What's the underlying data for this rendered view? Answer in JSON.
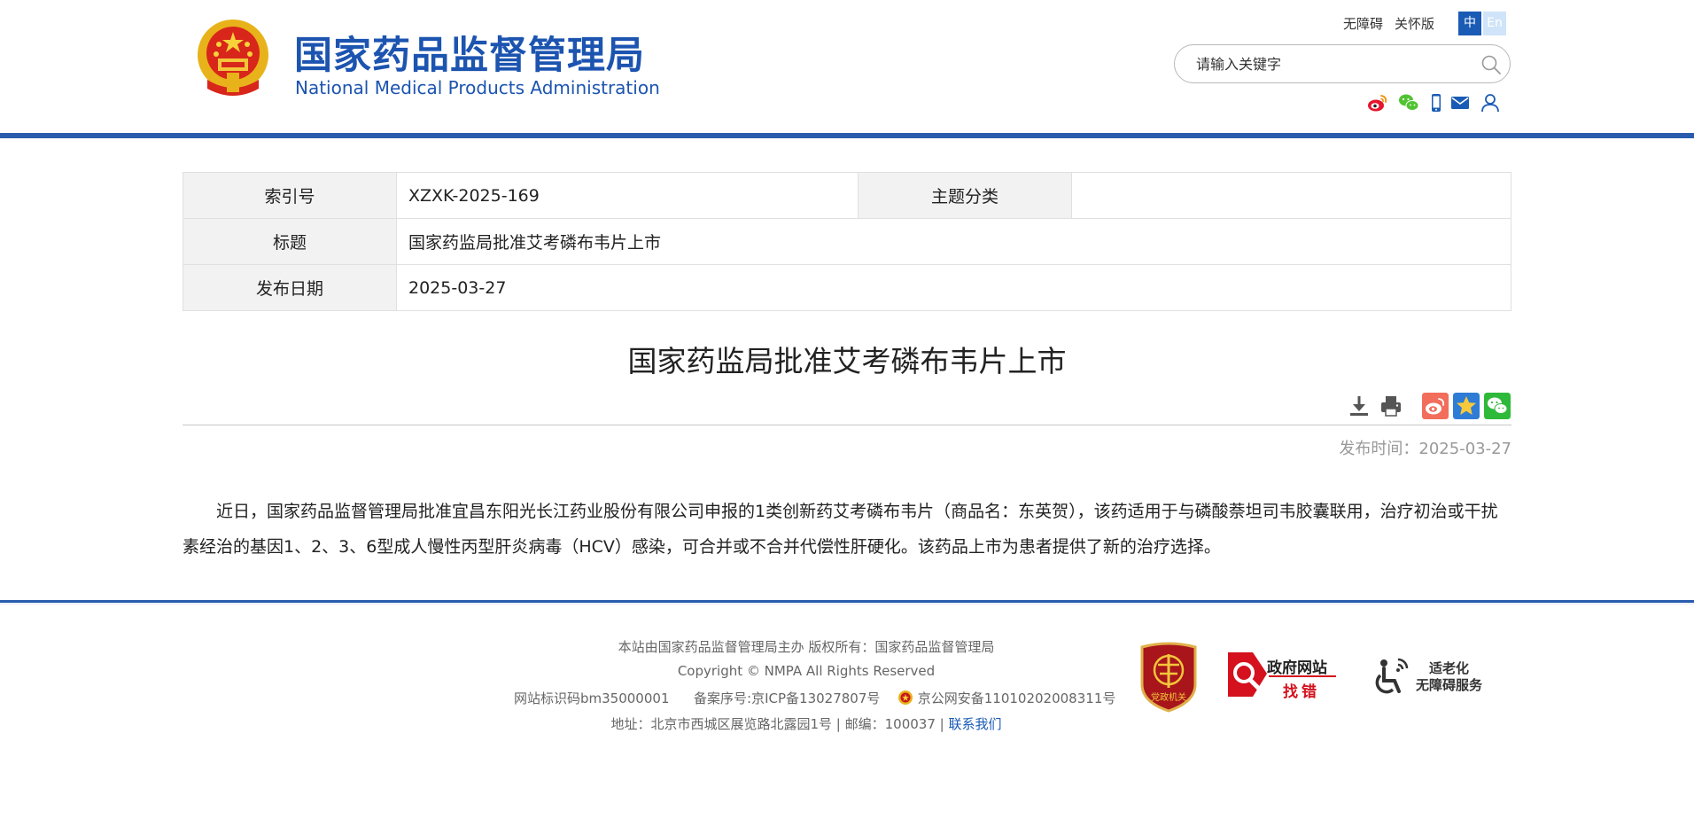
{
  "header": {
    "title_cn": "国家药品监督管理局",
    "title_en": "National Medical Products Administration",
    "accessibility_link": "无障碍",
    "elder_link": "关怀版",
    "lang_zh": "中",
    "lang_en": "En",
    "search": {
      "placeholder": "请输入关键字",
      "value": ""
    },
    "social_icons": [
      "weibo-icon",
      "wechat-icon",
      "mobile-icon",
      "mail-icon",
      "user-icon"
    ]
  },
  "meta": {
    "index_label": "索引号",
    "index_value": "XZXK-2025-169",
    "topic_label": "主题分类",
    "topic_value": "",
    "title_label": "标题",
    "title_value": "国家药监局批准艾考磷布韦片上市",
    "date_label": "发布日期",
    "date_value": "2025-03-27"
  },
  "article": {
    "title": "国家药监局批准艾考磷布韦片上市",
    "publish_time": "发布时间：2025-03-27",
    "body": "近日，国家药品监督管理局批准宜昌东阳光长江药业股份有限公司申报的1类创新药艾考磷布韦片（商品名：东英贺），该药适用于与磷酸萘坦司韦胶囊联用，治疗初治或干扰素经治的基因1、2、3、6型成人慢性丙型肝炎病毒（HCV）感染，可合并或不合并代偿性肝硬化。该药品上市为患者提供了新的治疗选择。"
  },
  "footer": {
    "line1": "本站由国家药品监督管理局主办 版权所有：国家药品监督管理局",
    "line2": "Copyright © NMPA All Rights Reserved",
    "site_id": "网站标识码bm35000001",
    "icp": "备案序号:京ICP备13027807号",
    "police": "京公网安备11010202008311号",
    "address": "地址：北京市西城区展览路北露园1号 | 邮编：100037 | ",
    "contact": "联系我们",
    "badge_party": "党政机关",
    "badge_error_line1": "政府网站",
    "badge_error_line2": "找错",
    "badge_elder_line1": "适老化",
    "badge_elder_line2": "无障碍服务"
  },
  "colors": {
    "brand_blue": "#1c54b0",
    "bar_blue": "#2a5cad",
    "weibo_red": "#e6162d",
    "wechat_green": "#51c332",
    "favorite_blue": "#2e7cd6",
    "badge_red": "#c8161d"
  }
}
